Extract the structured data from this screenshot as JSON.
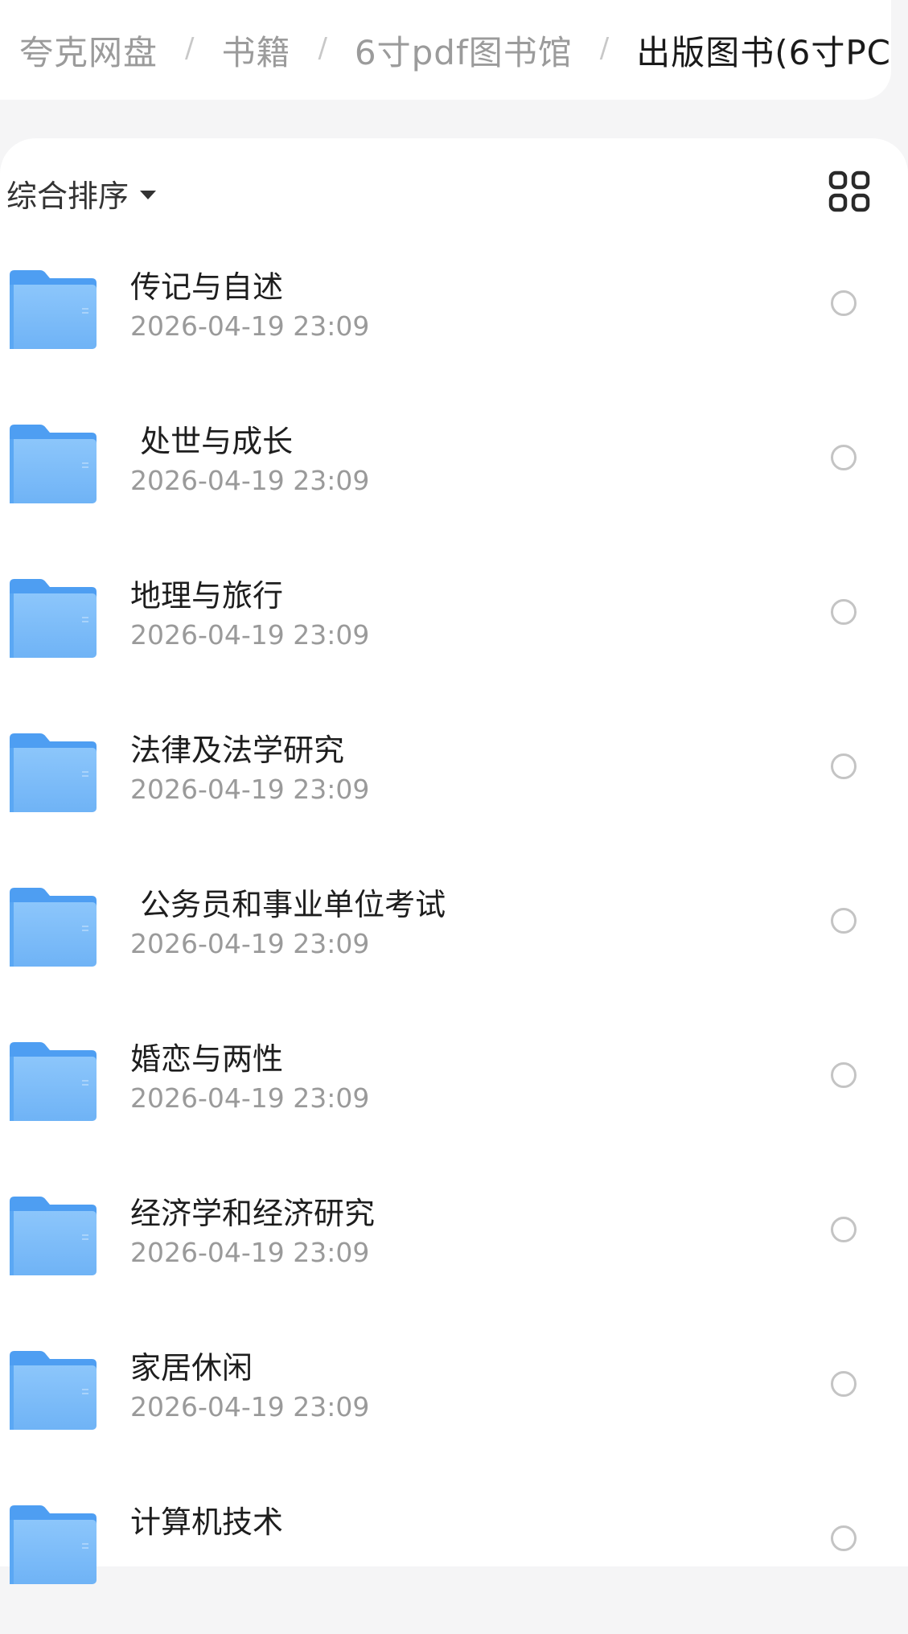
{
  "breadcrumb": [
    {
      "label": "夸克网盘",
      "current": false
    },
    {
      "label": "书籍",
      "current": false
    },
    {
      "label": "6寸pdf图书馆",
      "current": false
    },
    {
      "label": "出版图书(6寸PC",
      "current": true
    }
  ],
  "breadcrumb_separator": "/",
  "toolbar": {
    "sort_label": "综合排序",
    "view_toggle_icon": "grid-view-icon"
  },
  "colors": {
    "folder_blue": "#6fb3f6",
    "folder_tab": "#4e9ef2",
    "text_primary": "#1e1e1e",
    "text_secondary": "#9a9a9a"
  },
  "folders": [
    {
      "name": "传记与自述",
      "date": "2026-04-19 23:09"
    },
    {
      "name": " 处世与成长",
      "date": "2026-04-19 23:09"
    },
    {
      "name": "地理与旅行",
      "date": "2026-04-19 23:09"
    },
    {
      "name": "法律及法学研究",
      "date": "2026-04-19 23:09"
    },
    {
      "name": " 公务员和事业单位考试",
      "date": "2026-04-19 23:09"
    },
    {
      "name": "婚恋与两性",
      "date": "2026-04-19 23:09"
    },
    {
      "name": "经济学和经济研究",
      "date": "2026-04-19 23:09"
    },
    {
      "name": "家居休闲",
      "date": "2026-04-19 23:09"
    },
    {
      "name": "计算机技术",
      "date": ""
    }
  ]
}
